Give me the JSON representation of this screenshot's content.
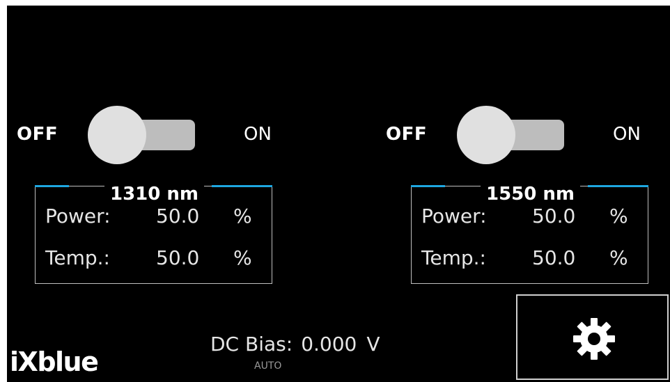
{
  "lasers": [
    {
      "toggle": {
        "off_label": "OFF",
        "on_label": "ON",
        "state": "off"
      },
      "title": "1310 nm",
      "power": {
        "label": "Power:",
        "value": "50.0",
        "unit": "%"
      },
      "temp": {
        "label": "Temp.:",
        "value": "50.0",
        "unit": "%"
      }
    },
    {
      "toggle": {
        "off_label": "OFF",
        "on_label": "ON",
        "state": "off"
      },
      "title": "1550 nm",
      "power": {
        "label": "Power:",
        "value": "50.0",
        "unit": "%"
      },
      "temp": {
        "label": "Temp.:",
        "value": "50.0",
        "unit": "%"
      }
    }
  ],
  "dc_bias": {
    "label": "DC Bias:",
    "value": "0.000",
    "unit": "V",
    "mode": "AUTO"
  },
  "settings": {
    "icon": "gear-icon"
  },
  "logo": {
    "text": "iXblue"
  },
  "colors": {
    "background": "#000000",
    "accent": "#1ea7e1",
    "switch_track": "#bdbdbd",
    "switch_knob": "#e0e0e0"
  }
}
